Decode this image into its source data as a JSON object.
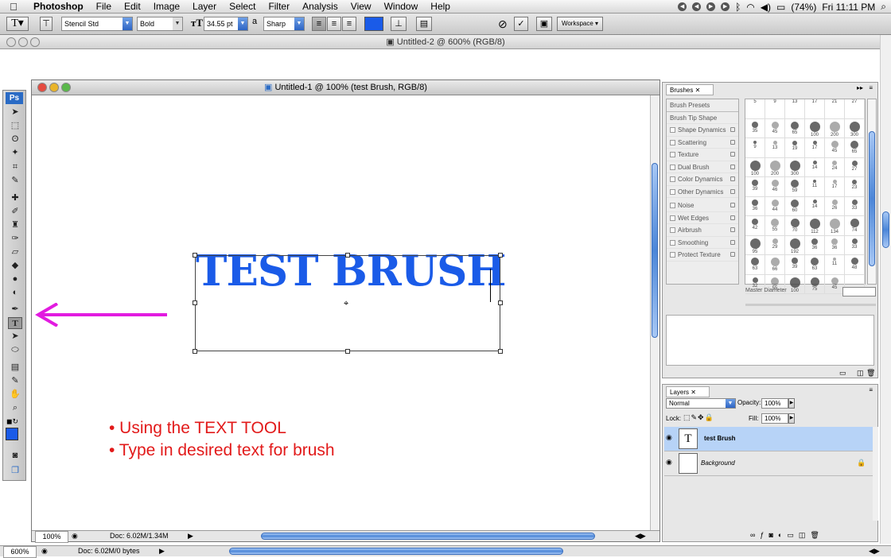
{
  "menubar": {
    "apple": "",
    "app_name": "Photoshop",
    "items": [
      "File",
      "Edit",
      "Image",
      "Layer",
      "Select",
      "Filter",
      "Analysis",
      "View",
      "Window",
      "Help"
    ],
    "battery": "(74%)",
    "clock": "Fri 11:11 PM"
  },
  "options": {
    "font_family": "Stencil Std",
    "font_style": "Bold",
    "font_size": "34.55 pt",
    "antialias_label": "a",
    "antialias": "Sharp",
    "text_color": "#1a5be8",
    "workspace": "Workspace"
  },
  "doc2": {
    "title": "Untitled-2 @ 600% (RGB/8)"
  },
  "tools": {
    "logo": "Ps",
    "foreground": "#1a5be8"
  },
  "document": {
    "title": "Untitled-1 @ 100% (test Brush, RGB/8)",
    "canvas_text": "TEST BRUSH",
    "zoom": "100%",
    "doc_info": "Doc: 6.02M/1.34M"
  },
  "annotation": {
    "color": "#e21a1a",
    "arrow_color": "#e21be0",
    "lines": [
      "• Using the TEXT TOOL",
      "• Type in desired text for brush"
    ]
  },
  "brushes": {
    "tab": "Brushes",
    "presets_label": "Brush Presets",
    "tip_shape": "Brush Tip Shape",
    "options": [
      "Shape Dynamics",
      "Scattering",
      "Texture",
      "Dual Brush",
      "Color Dynamics",
      "Other Dynamics",
      "Noise",
      "Wet Edges",
      "Airbrush",
      "Smoothing",
      "Protect Texture"
    ],
    "sizes": [
      "5",
      "9",
      "13",
      "17",
      "21",
      "27",
      "35",
      "45",
      "65",
      "100",
      "200",
      "300",
      "9",
      "13",
      "19",
      "17",
      "45",
      "65",
      "100",
      "200",
      "300",
      "14",
      "24",
      "27",
      "39",
      "46",
      "59",
      "11",
      "17",
      "23",
      "36",
      "44",
      "60",
      "14",
      "26",
      "33",
      "42",
      "55",
      "70",
      "112",
      "134",
      "74",
      "95",
      "29",
      "192",
      "36",
      "36",
      "33",
      "63",
      "66",
      "39",
      "63",
      "11",
      "48",
      "32",
      "55",
      "100",
      "75",
      "45",
      ""
    ],
    "master_diameter": "Master Diameter"
  },
  "layers": {
    "tab": "Layers",
    "blend_mode": "Normal",
    "opacity_label": "Opacity:",
    "opacity": "100%",
    "lock_label": "Lock:",
    "fill_label": "Fill:",
    "fill": "100%",
    "rows": [
      {
        "name": "test Brush",
        "thumb": "T",
        "selected": true
      },
      {
        "name": "Background",
        "thumb": "",
        "selected": false
      }
    ]
  },
  "bottom": {
    "zoom": "600%",
    "doc_info": "Doc: 6.02M/0 bytes"
  }
}
